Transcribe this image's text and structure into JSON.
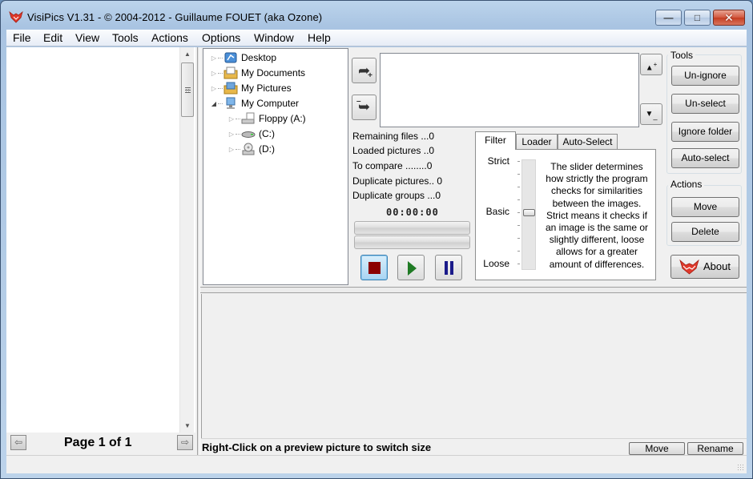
{
  "window": {
    "title": "VisiPics V1.31 - © 2004-2012 - Guillaume FOUET (aka Ozone)",
    "controls": {
      "minimize": "—",
      "maximize": "□",
      "close": "✕"
    }
  },
  "menu": [
    "File",
    "Edit",
    "View",
    "Tools",
    "Actions",
    "Options",
    "Window",
    "Help"
  ],
  "left_panel": {
    "page_label": "Page 1 of 1",
    "prev_icon": "page-prev-icon",
    "next_icon": "page-next-icon"
  },
  "tree": [
    {
      "label": "Desktop",
      "icon": "desktop-icon",
      "expanded": false,
      "level": 0
    },
    {
      "label": "My Documents",
      "icon": "documents-folder-icon",
      "expanded": false,
      "level": 0
    },
    {
      "label": "My Pictures",
      "icon": "pictures-folder-icon",
      "expanded": false,
      "level": 0
    },
    {
      "label": "My Computer",
      "icon": "computer-icon",
      "expanded": true,
      "level": 0
    },
    {
      "label": "Floppy (A:)",
      "icon": "floppy-drive-icon",
      "expanded": false,
      "level": 1
    },
    {
      "label": "(C:)",
      "icon": "hard-drive-icon",
      "expanded": false,
      "level": 1
    },
    {
      "label": "(D:)",
      "icon": "cd-drive-icon",
      "expanded": false,
      "level": 1
    }
  ],
  "folder_zone": {
    "add_icon": "add-folder-arrow-icon",
    "remove_icon": "remove-folder-arrow-icon",
    "priority_up_icon": "priority-up-icon",
    "priority_down_icon": "priority-down-icon",
    "plus": "+",
    "minus": "–",
    "up_glyph": "▲",
    "down_glyph": "▼",
    "items": []
  },
  "stats": [
    {
      "label": "Remaining files ...0"
    },
    {
      "label": "Loaded pictures ..0"
    },
    {
      "label": "To compare ........0"
    },
    {
      "label": "Duplicate pictures.. 0"
    },
    {
      "label": "Duplicate groups ...0"
    }
  ],
  "timer": "00:00:00",
  "progress": {
    "load_percent": 0,
    "compare_percent": 0
  },
  "controls": {
    "stop": "stop-icon",
    "play": "play-icon",
    "pause": "pause-icon",
    "active": "stop"
  },
  "tabs": [
    {
      "label": "Filter",
      "active": true
    },
    {
      "label": "Loader",
      "active": false
    },
    {
      "label": "Auto-Select",
      "active": false
    }
  ],
  "filter": {
    "scale": {
      "top": "Strict",
      "middle": "Basic",
      "bottom": "Loose"
    },
    "tick_count": 9,
    "slider_value": "Basic",
    "slider_fraction_from_top": 0.5,
    "help_text": "The slider determines how strictly the program checks for similarities between the images. Strict means it checks if an image is the same or slightly different, loose allows for a greater amount of differences."
  },
  "tools": {
    "group_label": "Tools",
    "buttons": [
      "Un-ignore",
      "Un-select",
      "Ignore folder",
      "Auto-select"
    ]
  },
  "actions": {
    "group_label": "Actions",
    "buttons": [
      "Move",
      "Delete"
    ]
  },
  "about_label": "About",
  "preview": {
    "hint": "Right-Click on a preview picture to switch size",
    "move_label": "Move",
    "rename_label": "Rename"
  },
  "colors": {
    "brand_fox": "#e0392b",
    "stop": "#8b0000",
    "play": "#1f7a24",
    "pause": "#1a1a8a",
    "titlebar": "#a9c4e2"
  }
}
